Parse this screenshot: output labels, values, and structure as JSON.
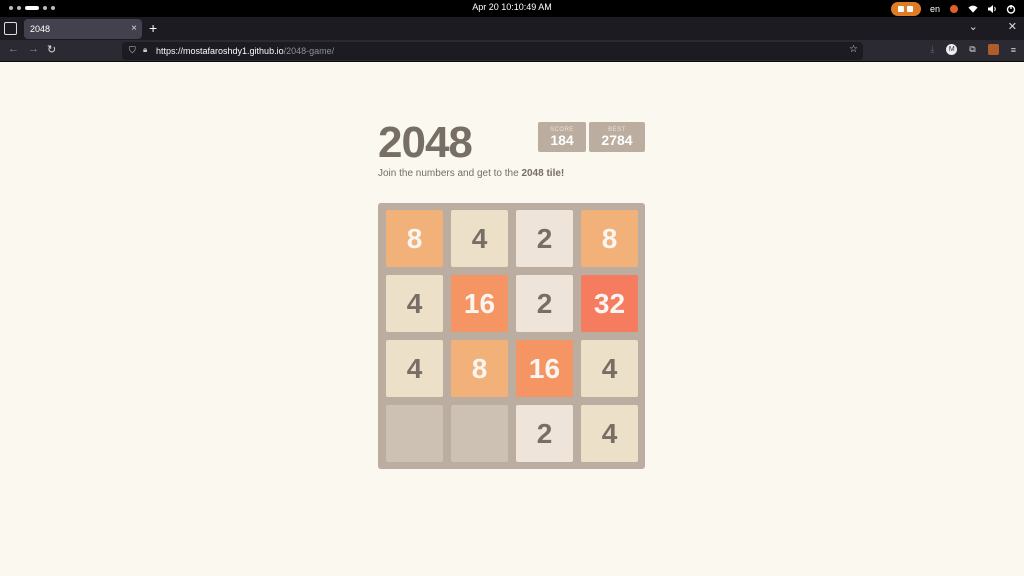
{
  "system": {
    "clock": "Apr 20  10:10:49 AM",
    "language": "en"
  },
  "browser": {
    "tab_title": "2048",
    "tab_close": "×",
    "new_tab": "+",
    "url_host": "https://mostafaroshdy1.github.io",
    "url_path": "/2048-game/"
  },
  "game": {
    "title": "2048",
    "score_label": "SCORE",
    "score": "184",
    "best_label": "BEST",
    "best": "2784",
    "intro_text": "Join the numbers and get to the ",
    "intro_bold": "2048 tile!",
    "grid": [
      [
        8,
        4,
        2,
        8
      ],
      [
        4,
        16,
        2,
        32
      ],
      [
        4,
        8,
        16,
        4
      ],
      [
        0,
        0,
        2,
        4
      ]
    ]
  },
  "colors": {
    "background": "#faf8ef",
    "board": "#bbada0",
    "empty": "#cdc1b4",
    "tile2": "#eee4da",
    "tile4": "#ede0c8",
    "tile8": "#f2b179",
    "tile16": "#f59563",
    "tile32": "#f67c5f",
    "text_dark": "#776e65"
  }
}
